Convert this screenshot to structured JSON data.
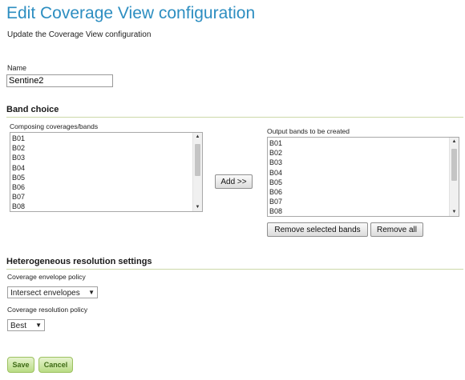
{
  "page": {
    "title": "Edit Coverage View configuration",
    "subtitle": "Update the Coverage View configuration"
  },
  "name": {
    "label": "Name",
    "value": "Sentine2"
  },
  "band_choice": {
    "title": "Band choice",
    "composing_label": "Composing coverages/bands",
    "composing_items": [
      "B01",
      "B02",
      "B03",
      "B04",
      "B05",
      "B06",
      "B07",
      "B08"
    ],
    "add_button": "Add >>",
    "output_label": "Output bands to be created",
    "output_items": [
      "B01",
      "B02",
      "B03",
      "B04",
      "B05",
      "B06",
      "B07",
      "B08"
    ],
    "remove_selected_button": "Remove selected bands",
    "remove_all_button": "Remove all"
  },
  "resolution": {
    "title": "Heterogeneous resolution settings",
    "envelope_label": "Coverage envelope policy",
    "envelope_value": "Intersect envelopes",
    "resolution_label": "Coverage resolution policy",
    "resolution_value": "Best"
  },
  "actions": {
    "save": "Save",
    "cancel": "Cancel"
  },
  "colors": {
    "title": "#2d8ec1",
    "section_line": "#ccd8a8",
    "green_button": "#b9dc85"
  },
  "icons": {
    "dropdown": "triangle-down",
    "scroll_up": "triangle-up",
    "scroll_down": "triangle-down"
  }
}
